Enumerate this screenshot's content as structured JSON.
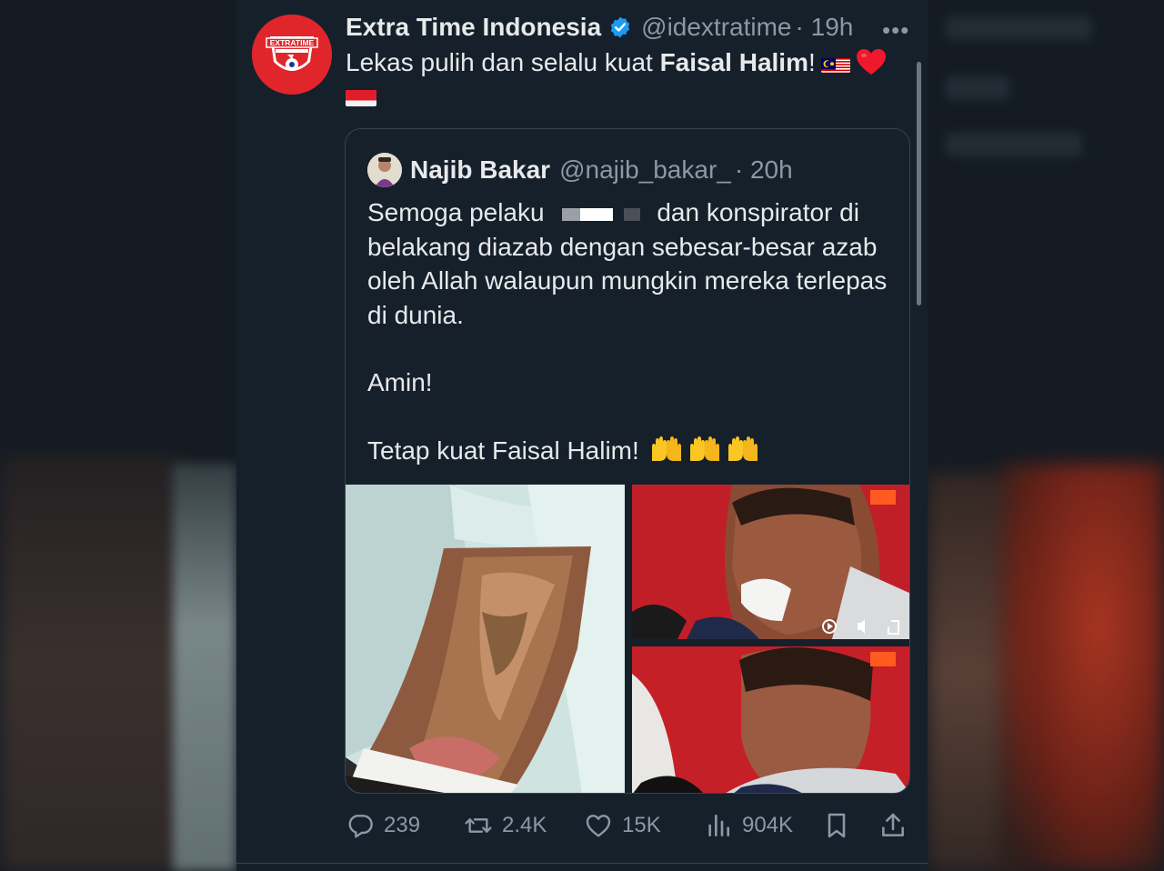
{
  "tweet": {
    "author_name": "Extra Time Indonesia",
    "author_handle": "@idextratime",
    "time": "· 19h",
    "text_prefix": "Lekas pulih dan selalu kuat ",
    "text_bold": "Faisal Halim",
    "text_suffix": "!",
    "emojis": [
      "malaysia-flag",
      "red-heart",
      "indonesia-flag"
    ],
    "avatar_text": "EXTRATIME"
  },
  "quoted": {
    "author_name": "Najib Bakar",
    "author_handle": "@najib_bakar_",
    "time": "· 20h",
    "line1_before": "Semoga pelaku ",
    "line1_after": "dan konspirator di belakang diazab dengan sebesar-besar azab oleh Allah walaupun mungkin mereka terlepas di dunia.",
    "line2": "Amin!",
    "line3": "Tetap kuat Faisal Halim! ",
    "line3_emojis": [
      "raising-hands",
      "raising-hands",
      "raising-hands"
    ]
  },
  "media": {
    "images": [
      "burned-arm-photo",
      "man-crying-press-photo",
      "man-press-conference-photo"
    ],
    "video_controls": [
      "play-icon",
      "volume-icon",
      "fullscreen-icon"
    ]
  },
  "actions": {
    "replies": "239",
    "reposts": "2.4K",
    "likes": "15K",
    "views": "904K"
  },
  "colors": {
    "background": "#15202b",
    "text": "#e7e9ea",
    "muted": "#8b98a5",
    "border": "#38444d",
    "verified": "#1d9bf0"
  }
}
